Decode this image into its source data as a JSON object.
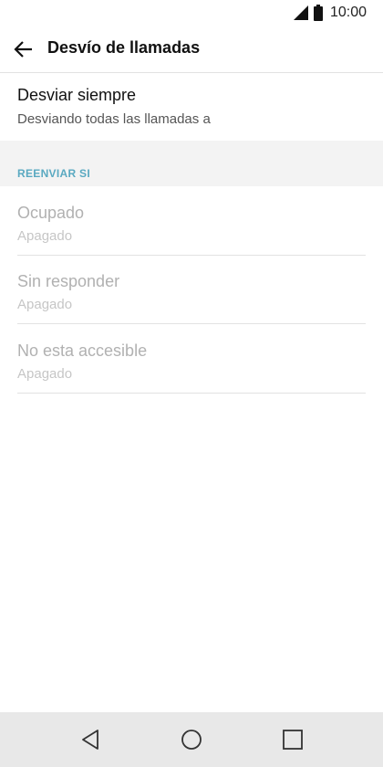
{
  "status_bar": {
    "time": "10:00",
    "signal_icon": "signal-icon",
    "battery_icon": "battery-icon"
  },
  "app_bar": {
    "back_icon": "back-arrow-icon",
    "title": "Desvío de llamadas"
  },
  "always_forward": {
    "title": "Desviar siempre",
    "subtitle": "Desviando todas las llamadas a"
  },
  "section": {
    "header": "REENVIAR SI"
  },
  "conditional_items": [
    {
      "title": "Ocupado",
      "subtitle": "Apagado"
    },
    {
      "title": "Sin responder",
      "subtitle": "Apagado"
    },
    {
      "title": "No esta accesible",
      "subtitle": "Apagado"
    }
  ],
  "nav_bar": {
    "back_icon": "nav-back-icon",
    "home_icon": "nav-home-icon",
    "recents_icon": "nav-recents-icon"
  },
  "colors": {
    "accent": "#5aa9c1",
    "disabled_text": "#b1b1b1",
    "band": "#f3f3f3",
    "nav_bar": "#e8e8e8"
  }
}
